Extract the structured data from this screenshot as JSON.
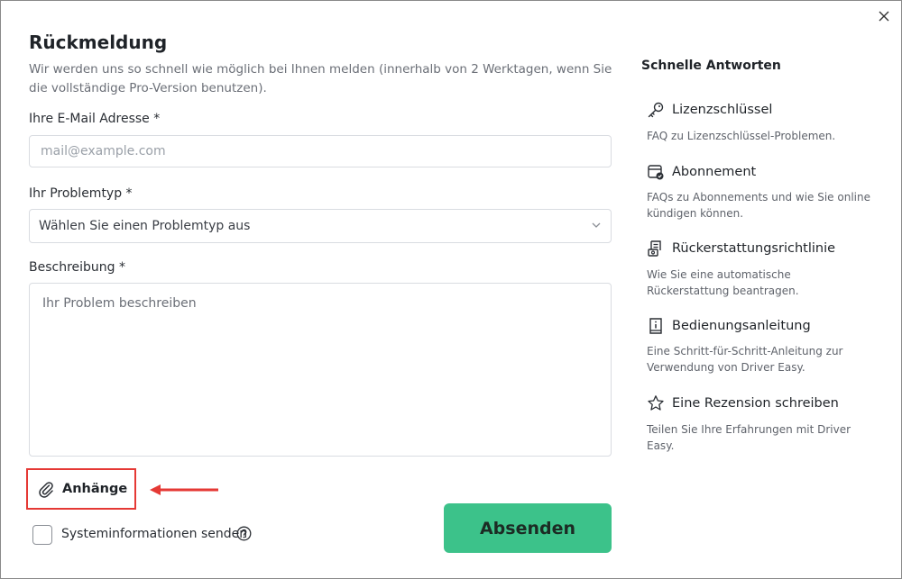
{
  "dialog": {
    "title": "Rückmeldung",
    "subtitle": "Wir werden uns so schnell wie möglich bei Ihnen melden (innerhalb von 2 Werktagen, wenn Sie die vollständige Pro-Version benutzen)."
  },
  "form": {
    "email_label": "Ihre E-Mail Adresse *",
    "email_placeholder": "mail@example.com",
    "email_value": "",
    "problem_label": "Ihr Problemtyp *",
    "problem_selected": "Wählen Sie einen Problemtyp aus",
    "description_label": "Beschreibung *",
    "description_placeholder": "Ihr Problem beschreiben",
    "description_value": "",
    "attachments_label": "Anhänge",
    "system_info_label": "Systeminformationen senden",
    "system_info_checked": false,
    "submit_label": "Absenden"
  },
  "quick_answers": {
    "title": "Schnelle Antworten",
    "items": [
      {
        "icon": "key-icon",
        "title": "Lizenzschlüssel",
        "description": "FAQ zu Lizenzschlüssel-Problemen."
      },
      {
        "icon": "subscription-icon",
        "title": "Abonnement",
        "description": "FAQs zu Abonnements und wie Sie online kündigen können."
      },
      {
        "icon": "refund-icon",
        "title": "Rückerstattungsrichtlinie",
        "description": "Wie Sie eine automatische Rückerstattung beantragen."
      },
      {
        "icon": "manual-icon",
        "title": "Bedienungsanleitung",
        "description": "Eine Schritt-für-Schritt-Anleitung zur Verwendung von Driver Easy."
      },
      {
        "icon": "star-icon",
        "title": "Eine Rezension schreiben",
        "description": "Teilen Sie Ihre Erfahrungen mit Driver Easy."
      }
    ]
  },
  "colors": {
    "accent": "#3cc28a",
    "highlight": "#e53935"
  },
  "icons": [
    "close-icon",
    "chevron-down-icon",
    "paperclip-icon",
    "arrow-left-icon",
    "help-circle-icon"
  ]
}
